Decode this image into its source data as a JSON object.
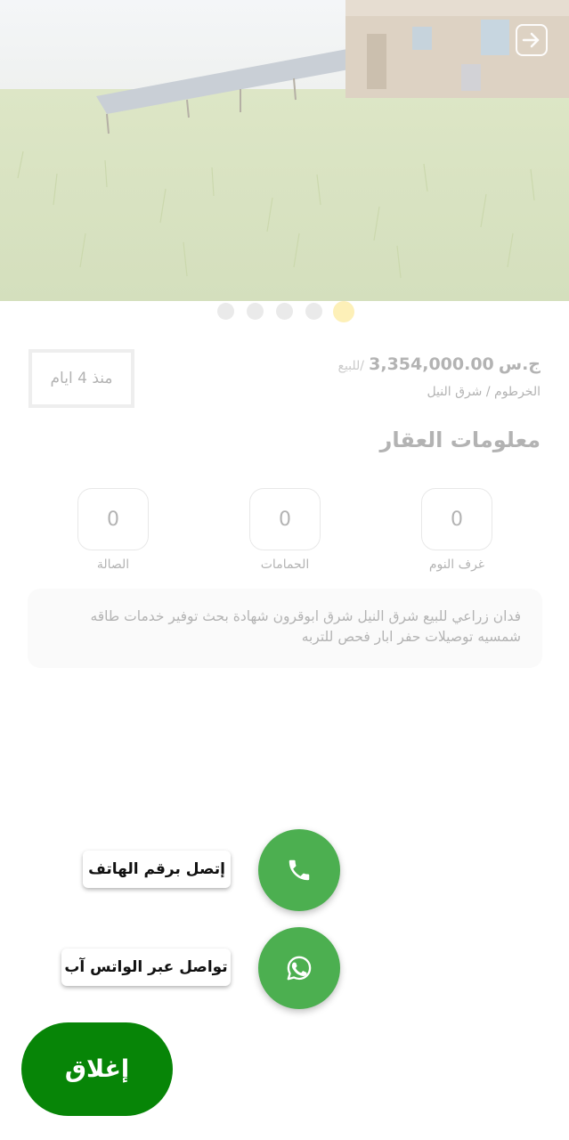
{
  "listing": {
    "currency": "ج.س",
    "price": "3,354,000.00",
    "price_suffix": "/للبيع",
    "location": "الخرطوم / شرق النيل",
    "posted": "منذ 4 ايام"
  },
  "section": {
    "title": "معلومات العقار"
  },
  "stats": [
    {
      "value": "0",
      "label": "غرف النوم"
    },
    {
      "value": "0",
      "label": "الحمامات"
    },
    {
      "value": "0",
      "label": "الصالة"
    }
  ],
  "description": "فدان زراعي للبيع شرق النيل شرق ابوقرون شهادة بحث توفير خدمات طاقه شمسيه توصيلات حفر ابار فحص للتربه",
  "carousel": {
    "count": 5,
    "active_index": 0
  },
  "actions": {
    "phone_label": "إتصل برقم الهاتف",
    "whatsapp_label": "تواصل عبر الواتس آب",
    "close_label": "إغلاق"
  },
  "colors": {
    "fab_green": "#4caf50",
    "close_green": "#078507",
    "active_dot": "#fdf0b8"
  },
  "icons": {
    "back": "arrow-right-box-icon",
    "phone": "phone-icon",
    "whatsapp": "whatsapp-icon"
  }
}
